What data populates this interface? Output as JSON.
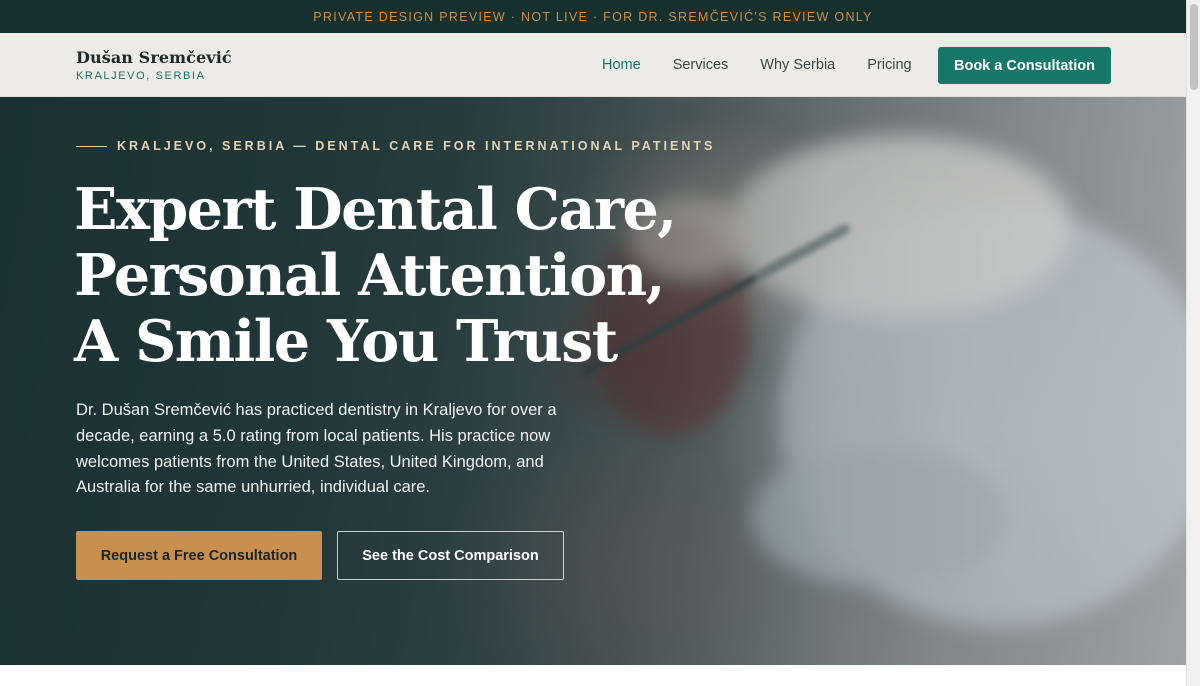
{
  "banner": {
    "text": "PRIVATE DESIGN PREVIEW · NOT LIVE · FOR DR. SREMČEVIĆ'S REVIEW ONLY"
  },
  "header": {
    "brand_name": "Dušan Sremčević",
    "brand_location": "KRALJEVO, SERBIA",
    "nav": [
      {
        "label": "Home",
        "active": true
      },
      {
        "label": "Services",
        "active": false
      },
      {
        "label": "Why Serbia",
        "active": false
      },
      {
        "label": "Pricing",
        "active": false
      }
    ],
    "cta_label": "Book a Consultation"
  },
  "hero": {
    "eyebrow": "KRALJEVO, SERBIA — DENTAL CARE FOR INTERNATIONAL PATIENTS",
    "title_lines": [
      "Expert Dental Care,",
      "Personal Attention,",
      "A Smile You Trust"
    ],
    "lede": "Dr. Dušan Sremčević has practiced dentistry in Kraljevo for over a decade, earning a 5.0 rating from local patients. His practice now welcomes patients from the United States, United Kingdom, and Australia for the same unhurried, individual care.",
    "primary_cta": "Request a Free Consultation",
    "secondary_cta": "See the Cost Comparison"
  },
  "colors": {
    "banner_bg": "#16302e",
    "banner_text": "#c98f4f",
    "accent_teal": "#17786a",
    "accent_gold": "#c98f4f"
  }
}
